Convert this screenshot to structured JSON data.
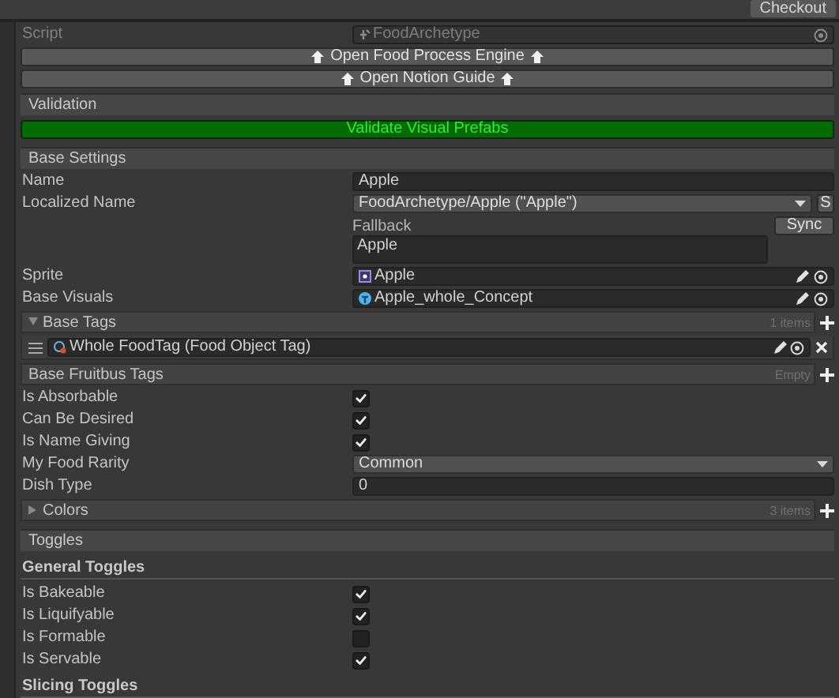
{
  "toolbar": {
    "checkout_button": "Checkout"
  },
  "script_field": {
    "label": "Script",
    "value": "FoodArchetype",
    "disabled": true
  },
  "link_buttons": [
    {
      "label": "Open Food Process Engine"
    },
    {
      "label": "Open Notion Guide"
    }
  ],
  "validation": {
    "header": "Validation",
    "button": "Validate Visual Prefabs"
  },
  "base_settings": {
    "header": "Base Settings",
    "rows": [
      {
        "kind": "text",
        "label": "Name",
        "value": "Apple"
      },
      {
        "kind": "localized",
        "label": "Localized Name",
        "value": "FoodArchetype/Apple (\"Apple\")",
        "button": "S",
        "fallback_label": "Fallback",
        "sync_button": "Sync",
        "fallback_value": "Apple"
      },
      {
        "kind": "sprite_ref",
        "label": "Sprite",
        "value": "Apple"
      },
      {
        "kind": "prefab_ref",
        "label": "Base Visuals",
        "value": "Apple_whole_Concept"
      },
      {
        "kind": "list",
        "header": "Base Tags",
        "expanded": true,
        "count": "1 items",
        "items": [
          {
            "label": "Whole FoodTag (Food Object Tag)"
          }
        ]
      },
      {
        "kind": "flat_list",
        "header": "Base Fruitbus Tags",
        "count": "Empty"
      },
      {
        "kind": "toggle",
        "label": "Is Absorbable",
        "checked": true
      },
      {
        "kind": "toggle",
        "label": "Can Be Desired",
        "checked": true
      },
      {
        "kind": "toggle",
        "label": "Is Name Giving",
        "checked": true
      },
      {
        "kind": "dropdown",
        "label": "My Food Rarity",
        "value": "Common"
      },
      {
        "kind": "text",
        "label": "Dish Type",
        "value": "0"
      },
      {
        "kind": "list",
        "header": "Colors",
        "expanded": false,
        "count": "3 items"
      }
    ]
  },
  "toggles": {
    "header": "Toggles",
    "groups": [
      {
        "title": "General Toggles",
        "rows": [
          {
            "label": "Is Bakeable",
            "checked": true
          },
          {
            "label": "Is Liquifyable",
            "checked": true
          },
          {
            "label": "Is Formable",
            "checked": false
          },
          {
            "label": "Is Servable",
            "checked": true
          }
        ]
      },
      {
        "title": "Slicing Toggles"
      }
    ]
  }
}
